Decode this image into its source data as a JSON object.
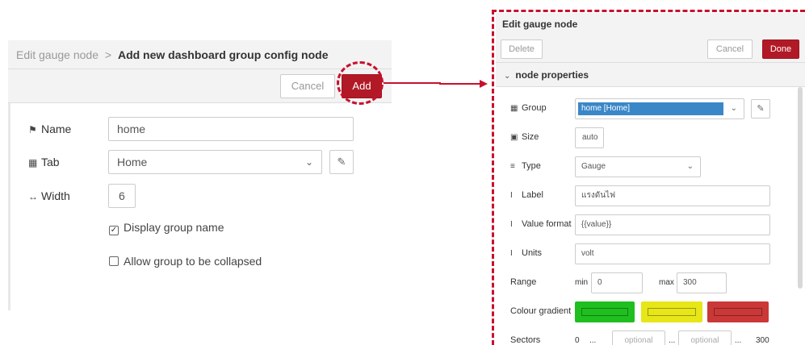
{
  "left": {
    "breadcrumb_parent": "Edit gauge node",
    "breadcrumb_sep": ">",
    "breadcrumb_current": "Add new dashboard group config node",
    "cancel_label": "Cancel",
    "add_label": "Add",
    "name_label": "Name",
    "name_value": "home",
    "tab_label": "Tab",
    "tab_value": "Home",
    "width_label": "Width",
    "width_value": "6",
    "display_group_name": "Display group name",
    "display_group_name_checked": true,
    "allow_collapse": "Allow group to be collapsed",
    "allow_collapse_checked": false
  },
  "right": {
    "title": "Edit gauge node",
    "delete_label": "Delete",
    "cancel_label": "Cancel",
    "done_label": "Done",
    "section_label": "node properties",
    "group_label": "Group",
    "group_value": "home [Home]",
    "size_label": "Size",
    "size_value": "auto",
    "type_label": "Type",
    "type_value": "Gauge",
    "label_label": "Label",
    "label_value": "แรงดันไฟ",
    "value_format_label": "Value format",
    "value_format_value": "{{value}}",
    "units_label": "Units",
    "units_value": "volt",
    "range_label": "Range",
    "min_label": "min",
    "min_value": "0",
    "max_label": "max",
    "max_value": "300",
    "colour_gradient_label": "Colour gradient",
    "colours": [
      "#1fbf1f",
      "#e6e619",
      "#ca3838"
    ],
    "sectors_label": "Sectors",
    "sector_start": "0",
    "sector_dots": "...",
    "sector_placeholder_1": "optional",
    "sector_placeholder_2": "optional",
    "sector_end": "300"
  },
  "accent_color": "#b11926",
  "highlight_color": "#c8102e"
}
